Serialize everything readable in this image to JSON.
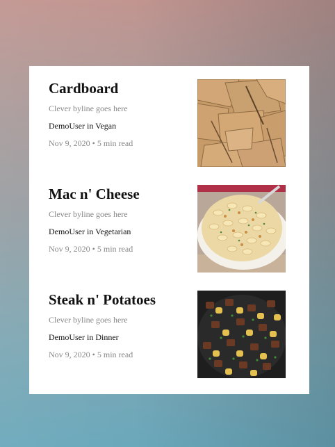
{
  "posts": [
    {
      "title": "Cardboard",
      "byline": "Clever byline goes here",
      "author": "DemoUser",
      "in_word": "in",
      "category": "Vegan",
      "date": "Nov 9, 2020",
      "separator": "•",
      "read_time": "5 min read",
      "thumb_icon": "cardboard-image"
    },
    {
      "title": "Mac n' Cheese",
      "byline": "Clever byline goes here",
      "author": "DemoUser",
      "in_word": "in",
      "category": "Vegetarian",
      "date": "Nov 9, 2020",
      "separator": "•",
      "read_time": "5 min read",
      "thumb_icon": "mac-and-cheese-image"
    },
    {
      "title": "Steak n' Potatoes",
      "byline": "Clever byline goes here",
      "author": "DemoUser",
      "in_word": "in",
      "category": "Dinner",
      "date": "Nov 9, 2020",
      "separator": "•",
      "read_time": "5 min read",
      "thumb_icon": "steak-and-potatoes-image"
    }
  ],
  "colors": {
    "card_background": "#ffffff",
    "title_text": "#111111",
    "muted_text": "#888888"
  }
}
